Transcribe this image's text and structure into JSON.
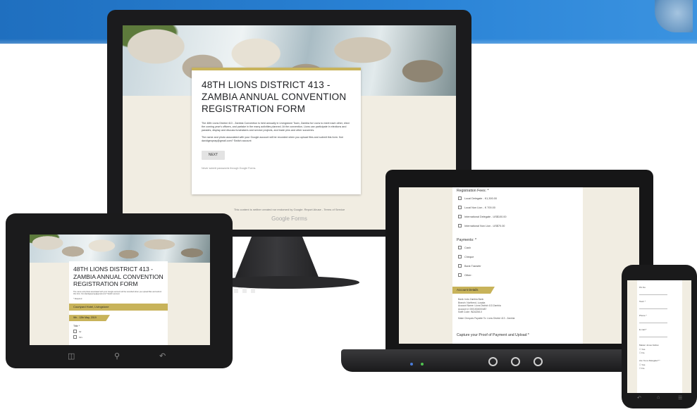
{
  "desktop": {
    "title": "48TH LIONS DISTRICT 413 - ZAMBIA ANNUAL CONVENTION REGISTRATION FORM",
    "description": "The 48th Lions District 413 - Zambia Convention is held annually in Livingstone Town, Zambia for Lions to meet each other, elect the coming year's officers, and partake in the many activities planned. At the convention, Lions can participate in elections and parades, display and discuss fundraisers and service projects, and trade pins and other souvenirs.",
    "account_notice": "The name and photo associated with your Google account will be recorded when you upload files and submit this form. Not davidgeopray@gmail.com? Switch account",
    "next_button": "NEXT",
    "never_submit": "Never submit passwords through Google Forms.",
    "footer": "This content is neither created nor endorsed by Google. Report Abuse - Terms of Service",
    "brand": "Google Forms"
  },
  "laptop": {
    "fees_heading": "Registration Fees: *",
    "fees": [
      "Local Delegate - K1,300.00",
      "Local Non Lion - K 700.00",
      "International Delegate - US$100.00",
      "International Non Lion - US$70.00"
    ],
    "payments_heading": "Payments: *",
    "payments": [
      "Cash",
      "Cheque",
      "Bank Transfer",
      "Other:"
    ],
    "account_band": "Account Details",
    "account_lines": [
      "Bank: Indo Zambia Bank",
      "Branch: Northend, Lusaka",
      "Account Name: Lions District 413 Zambia",
      "Account #: 0001004000487",
      "Swift Code: INZAZMLX",
      "",
      "Make Cheques Payable To: Lions District 413 - Zambia"
    ],
    "upload_heading": "Capture your Proof of Payment and Upload *"
  },
  "tablet": {
    "title": "48TH LIONS DISTRICT 413 - ZAMBIA ANNUAL CONVENTION REGISTRATION FORM",
    "fine": "The name and photo associated with your Google account will be recorded when you upload files and submit this form. Not davidgeopray@gmail.com? Switch account",
    "required": "* Required",
    "venue_band": "Courtyard Hotel, Livingstone",
    "date_band": "9th - 12th May, 2019",
    "title_question": "Title *",
    "title_options": [
      "Mr",
      "Mrs"
    ]
  },
  "phone": {
    "fields": [
      "Pin No",
      "Town *",
      "Phone *",
      "E-mail *",
      "Master Jones Fellow",
      "Are You a Delegate? *"
    ],
    "yes_no": [
      "Yes",
      "No"
    ]
  },
  "colors": {
    "banner": "#1f6fbf",
    "form_accent": "#c8b35a",
    "form_background": "#f1ede2",
    "device_bezel": "#1b1b1d"
  },
  "icons": {
    "tablet_nav": [
      "windows-icon",
      "search-icon",
      "back-icon"
    ],
    "laptop_buttons": [
      "blue-led-icon",
      "green-led-icon",
      "circle-button-icon"
    ]
  }
}
